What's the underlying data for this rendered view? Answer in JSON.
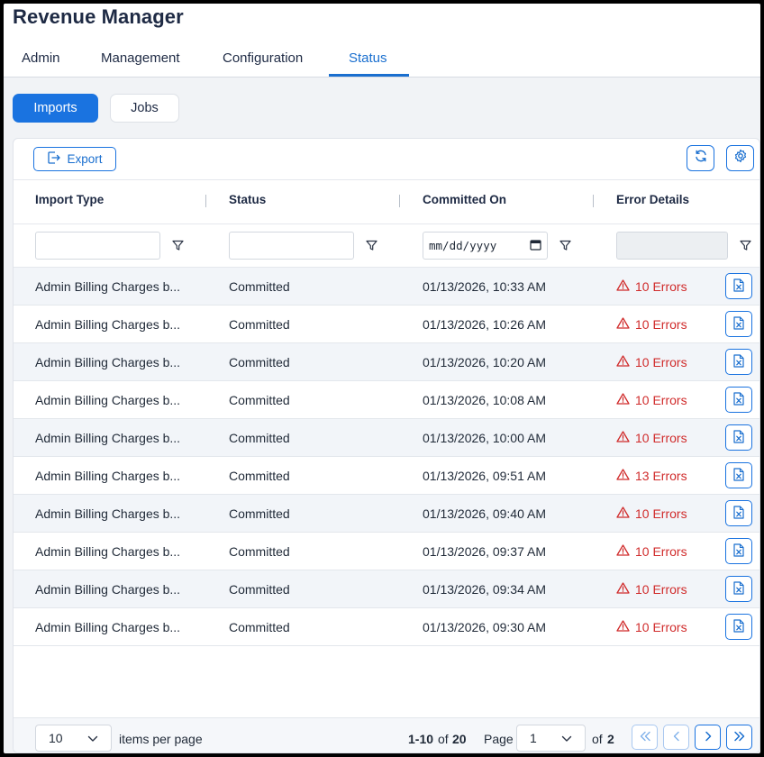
{
  "app": {
    "title": "Revenue Manager"
  },
  "nav": {
    "tabs": [
      {
        "label": "Admin",
        "active": false
      },
      {
        "label": "Management",
        "active": false
      },
      {
        "label": "Configuration",
        "active": false
      },
      {
        "label": "Status",
        "active": true
      }
    ]
  },
  "subtabs": {
    "imports": "Imports",
    "jobs": "Jobs",
    "selected": "Imports"
  },
  "toolbar": {
    "export_label": "Export",
    "export_icon": "export-icon",
    "refresh_icon": "refresh-icon",
    "settings_icon": "gear-icon"
  },
  "table": {
    "columns": [
      "Import Type",
      "Status",
      "Committed On",
      "Error Details"
    ],
    "filters": {
      "import_type": "",
      "status": "",
      "committed_on_placeholder": "mm/dd/yyyy",
      "error_details": ""
    },
    "rows": [
      {
        "import_type": "Admin Billing Charges b...",
        "status": "Committed",
        "committed_on": "01/13/2026, 10:33 AM",
        "errors": "10 Errors"
      },
      {
        "import_type": "Admin Billing Charges b...",
        "status": "Committed",
        "committed_on": "01/13/2026, 10:26 AM",
        "errors": "10 Errors"
      },
      {
        "import_type": "Admin Billing Charges b...",
        "status": "Committed",
        "committed_on": "01/13/2026, 10:20 AM",
        "errors": "10 Errors"
      },
      {
        "import_type": "Admin Billing Charges b...",
        "status": "Committed",
        "committed_on": "01/13/2026, 10:08 AM",
        "errors": "10 Errors"
      },
      {
        "import_type": "Admin Billing Charges b...",
        "status": "Committed",
        "committed_on": "01/13/2026, 10:00 AM",
        "errors": "10 Errors"
      },
      {
        "import_type": "Admin Billing Charges b...",
        "status": "Committed",
        "committed_on": "01/13/2026, 09:51 AM",
        "errors": "13 Errors"
      },
      {
        "import_type": "Admin Billing Charges b...",
        "status": "Committed",
        "committed_on": "01/13/2026, 09:40 AM",
        "errors": "10 Errors"
      },
      {
        "import_type": "Admin Billing Charges b...",
        "status": "Committed",
        "committed_on": "01/13/2026, 09:37 AM",
        "errors": "10 Errors"
      },
      {
        "import_type": "Admin Billing Charges b...",
        "status": "Committed",
        "committed_on": "01/13/2026, 09:34 AM",
        "errors": "10 Errors"
      },
      {
        "import_type": "Admin Billing Charges b...",
        "status": "Committed",
        "committed_on": "01/13/2026, 09:30 AM",
        "errors": "10 Errors"
      }
    ]
  },
  "pagination": {
    "page_size": "10",
    "items_per_page_label": "items per page",
    "range": "1-10",
    "of_label": "of",
    "total": "20",
    "page_label": "Page",
    "current_page": "1",
    "page_of_label": "of",
    "total_pages": "2"
  },
  "colors": {
    "accent": "#1a73e0",
    "error": "#d02b2b",
    "title": "#1e2a44"
  }
}
